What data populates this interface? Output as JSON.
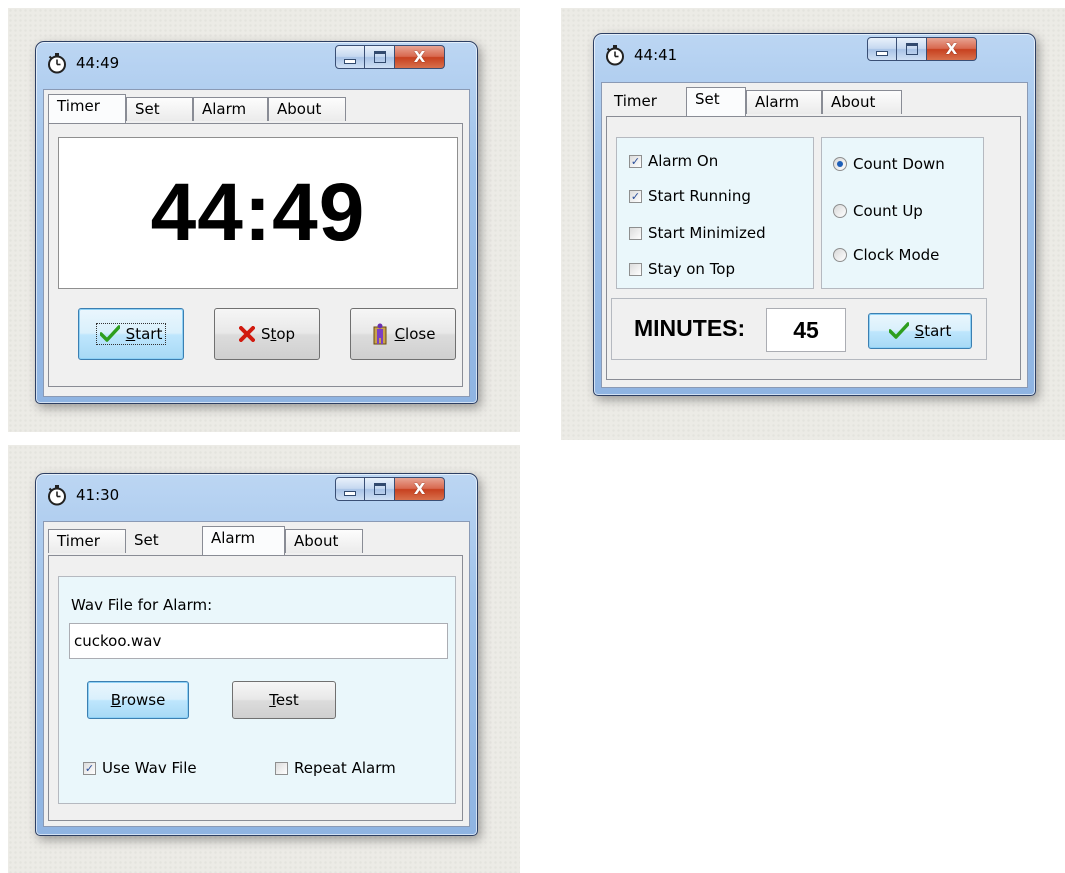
{
  "window_timer": {
    "title": "44:49",
    "tabs": [
      "Timer",
      "Set",
      "Alarm",
      "About"
    ],
    "active_tab": "Timer",
    "display": "44:49",
    "buttons": {
      "start": {
        "prefix": "",
        "accel": "S",
        "rest": "tart"
      },
      "stop": {
        "prefix": "S",
        "accel": "t",
        "rest": "op"
      },
      "close": {
        "prefix": "",
        "accel": "C",
        "rest": "lose"
      }
    }
  },
  "window_set": {
    "title": "44:41",
    "tabs": [
      "Timer",
      "Set",
      "Alarm",
      "About"
    ],
    "active_tab": "Set",
    "options": {
      "alarm_on": {
        "label": "Alarm On",
        "checked": true
      },
      "start_running": {
        "label": "Start Running",
        "checked": true
      },
      "start_minimized": {
        "label": "Start Minimized",
        "checked": false
      },
      "stay_on_top": {
        "label": "Stay on Top",
        "checked": false
      }
    },
    "modes": {
      "count_down": {
        "label": "Count Down",
        "selected": true
      },
      "count_up": {
        "label": "Count Up",
        "selected": false
      },
      "clock_mode": {
        "label": "Clock Mode",
        "selected": false
      }
    },
    "minutes_label": "MINUTES:",
    "minutes_value": "45",
    "start": {
      "accel": "S",
      "rest": "tart"
    }
  },
  "window_alarm": {
    "title": "41:30",
    "tabs": [
      "Timer",
      "Set",
      "Alarm",
      "About"
    ],
    "active_tab": "Alarm",
    "wav_label": "Wav File for Alarm:",
    "wav_value": "cuckoo.wav",
    "browse": {
      "accel": "B",
      "rest": "rowse"
    },
    "test": {
      "accel": "T",
      "rest": "est"
    },
    "use_wav": {
      "label": "Use Wav File",
      "checked": true
    },
    "repeat_alarm": {
      "label": "Repeat Alarm",
      "checked": false
    }
  },
  "colors": {
    "frame_blue": "#9fc2ea",
    "close_red": "#c7401f",
    "check_green": "#2e9e1f",
    "stop_red": "#d11a0f"
  }
}
